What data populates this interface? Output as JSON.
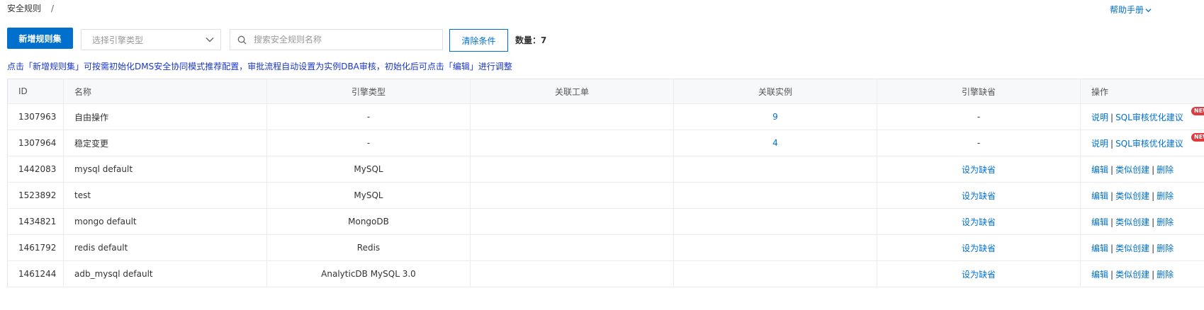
{
  "breadcrumb": {
    "title": "安全规则",
    "separator": "/"
  },
  "help": {
    "label": "帮助手册"
  },
  "toolbar": {
    "new_button": "新增规则集",
    "engine_select_placeholder": "选择引擎类型",
    "search_placeholder": "搜索安全规则名称",
    "clear_button": "清除条件",
    "count_label": "数量：7"
  },
  "tip": "点击「新增规则集」可按需初始化DMS安全协同模式推荐配置，审批流程自动设置为实例DBA审核，初始化后可点击「编辑」进行调整",
  "table": {
    "headers": [
      "ID",
      "名称",
      "引擎类型",
      "关联工单",
      "关联实例",
      "引擎缺省",
      "操作"
    ],
    "rows": [
      {
        "id": "1307963",
        "name": "自由操作",
        "engine": "-",
        "ticket": "",
        "instances": "9",
        "default": "-",
        "ops": [
          "说明",
          "SQL审核优化建议"
        ],
        "badge": "NEW"
      },
      {
        "id": "1307964",
        "name": "稳定变更",
        "engine": "-",
        "ticket": "",
        "instances": "4",
        "default": "-",
        "ops": [
          "说明",
          "SQL审核优化建议"
        ],
        "badge": "NEW"
      },
      {
        "id": "1442083",
        "name": "mysql default",
        "engine": "MySQL",
        "ticket": "",
        "instances": "",
        "default": "设为缺省",
        "ops": [
          "编辑",
          "类似创建",
          "删除"
        ]
      },
      {
        "id": "1523892",
        "name": "test",
        "engine": "MySQL",
        "ticket": "",
        "instances": "",
        "default": "设为缺省",
        "ops": [
          "编辑",
          "类似创建",
          "删除"
        ]
      },
      {
        "id": "1434821",
        "name": "mongo default",
        "engine": "MongoDB",
        "ticket": "",
        "instances": "",
        "default": "设为缺省",
        "ops": [
          "编辑",
          "类似创建",
          "删除"
        ]
      },
      {
        "id": "1461792",
        "name": "redis default",
        "engine": "Redis",
        "ticket": "",
        "instances": "",
        "default": "设为缺省",
        "ops": [
          "编辑",
          "类似创建",
          "删除"
        ]
      },
      {
        "id": "1461244",
        "name": "adb_mysql default",
        "engine": "AnalyticDB MySQL 3.0",
        "ticket": "",
        "instances": "",
        "default": "设为缺省",
        "ops": [
          "编辑",
          "类似创建",
          "删除"
        ]
      }
    ]
  },
  "colors": {
    "primary": "#0070cc",
    "tip": "#1a37c8",
    "badge": "#e0393e",
    "header_bg": "#f7f8fa"
  },
  "icons": {
    "dropdown": "chevron-down-icon",
    "search": "search-icon"
  }
}
